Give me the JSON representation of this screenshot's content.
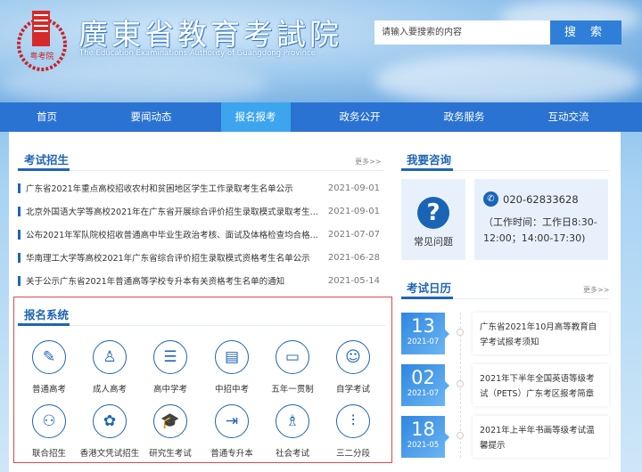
{
  "header": {
    "title_cn": "廣東省教育考試院",
    "title_en": "The Education Examinations Authority of Guangdong Province",
    "logo_text": "粤考院",
    "search_placeholder": "请输入要搜索的内容",
    "search_button": "搜 索"
  },
  "nav": [
    {
      "label": "首页"
    },
    {
      "label": "要闻动态"
    },
    {
      "label": "报名报考"
    },
    {
      "label": "政务公开"
    },
    {
      "label": "政务服务"
    },
    {
      "label": "互动交流"
    }
  ],
  "exam_news": {
    "title": "考试招生",
    "more": "更多>>",
    "items": [
      {
        "title": "广东省2021年重点高校招收农村和贫困地区学生工作录取考生名单公示",
        "date": "2021-09-01"
      },
      {
        "title": "北京外国语大学等高校2021年在广东省开展综合评价招生录取模式录取考生...",
        "date": "2021-09-01"
      },
      {
        "title": "公布2021年军队院校招收普通高中毕业生政治考核、面试及体格检查均合格...",
        "date": "2021-07-07"
      },
      {
        "title": "华南理工大学等高校2021年广东省综合评价招生录取模式资格考生名单公示",
        "date": "2021-06-28"
      },
      {
        "title": "关于公示广东省2021年普通高等学校专升本有关资格考生名单的通知",
        "date": "2021-05-14"
      }
    ]
  },
  "consult": {
    "title": "我要咨询",
    "faq": "常见问题",
    "phone": "020-62833628",
    "hours": "（工作时间：工作日8:30-12:00；14:00-17:30)"
  },
  "calendar": {
    "title": "考试日历",
    "more": "更多>>",
    "items": [
      {
        "day": "13",
        "ym": "2021-07",
        "text": "广东省2021年10月高等教育自学考试报考须知"
      },
      {
        "day": "02",
        "ym": "2021-07",
        "text": "2021年下半年全国英语等级考试（PETS）广东考区报考简章"
      },
      {
        "day": "18",
        "ym": "2021-05",
        "text": "2021年上半年书画等级考试温馨提示"
      }
    ]
  },
  "registration": {
    "title": "报名系统",
    "items": [
      {
        "label": "普通高考",
        "icon": "✎"
      },
      {
        "label": "成人高考",
        "icon": "♙"
      },
      {
        "label": "高中学考",
        "icon": "☰"
      },
      {
        "label": "中招中考",
        "icon": "▤"
      },
      {
        "label": "五年一贯制",
        "icon": "▭"
      },
      {
        "label": "自学考试",
        "icon": "☺"
      },
      {
        "label": "联合招生",
        "icon": "⚇"
      },
      {
        "label": "香港文凭试招生",
        "icon": "✿"
      },
      {
        "label": "研究生考试",
        "icon": "🎓"
      },
      {
        "label": "普通专升本",
        "icon": "⇥"
      },
      {
        "label": "社会考试",
        "icon": "♗"
      },
      {
        "label": "三二分段",
        "icon": "⫶"
      }
    ]
  }
}
